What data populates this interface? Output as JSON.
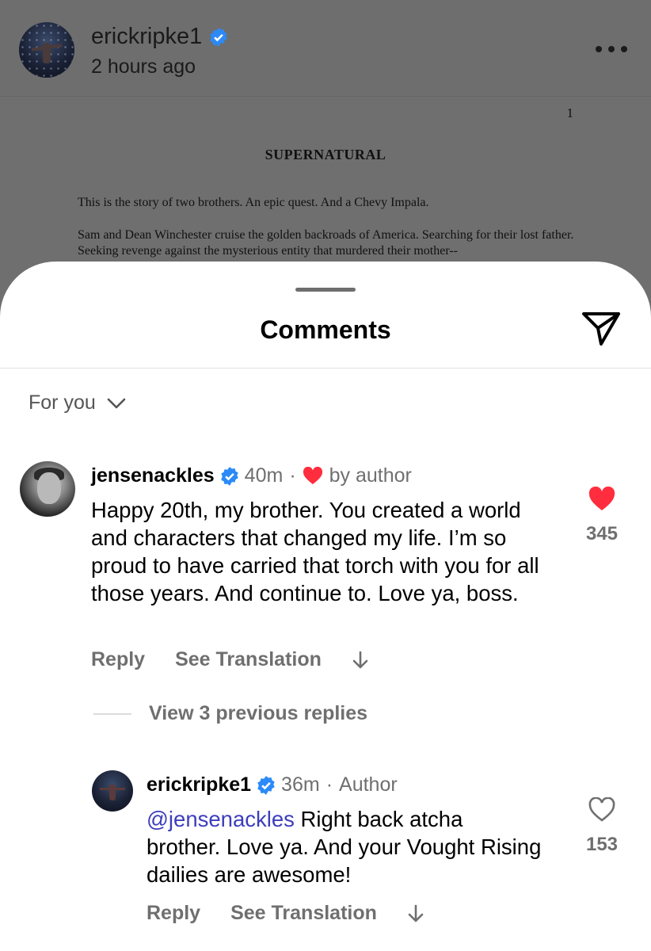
{
  "post": {
    "username": "erickripke1",
    "time": "2 hours ago",
    "doc_page_number": "1",
    "doc_title": "SUPERNATURAL",
    "doc_paragraph1": "This is the story of two brothers.  An epic quest.  And a Chevy Impala.",
    "doc_paragraph2": "Sam and Dean Winchester cruise the golden backroads of America.  Searching for their lost father.  Seeking revenge against the mysterious entity that murdered their mother--"
  },
  "sheet": {
    "title": "Comments",
    "filter_label": "For you"
  },
  "comments": [
    {
      "username": "jensenackles",
      "time": "40m",
      "liked_by": "by author",
      "text": "Happy 20th, my brother. You created a world and characters that changed my life. I’m so proud to have carried that torch with you for all those years. And continue to. Love ya, boss.",
      "likes": "345",
      "reply_label": "Reply",
      "translate_label": "See Translation",
      "liked": true
    },
    {
      "username": "erickripke1",
      "time": "36m",
      "author_tag": "Author",
      "mention": "@jensenackles",
      "text": " Right back atcha brother. Love ya. And your Vought Rising dailies are awesome!",
      "likes": "153",
      "reply_label": "Reply",
      "translate_label": "See Translation",
      "liked": false
    }
  ],
  "view_replies_label": "View 3 previous replies",
  "colors": {
    "verified_blue": "#2b8af7",
    "heart_red": "#ff2d3d",
    "mention_blue": "#3d3dbd",
    "meta_gray": "#6f6f6f"
  },
  "icons": [
    "verified-badge-icon",
    "more-options-icon",
    "send-icon",
    "chevron-down-icon",
    "heart-icon",
    "arrow-down-icon"
  ]
}
